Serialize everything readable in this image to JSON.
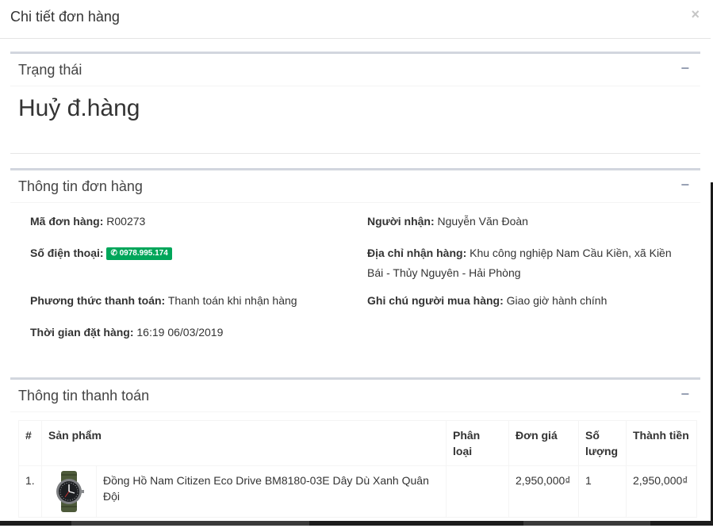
{
  "modal": {
    "title": "Chi tiết đơn hàng",
    "close_icon": "×"
  },
  "status_box": {
    "title": "Trạng thái",
    "collapse_icon": "−",
    "status": "Huỷ đ.hàng"
  },
  "order_box": {
    "title": "Thông tin đơn hàng",
    "collapse_icon": "−",
    "order_code_label": "Mã đơn hàng:",
    "order_code": "R00273",
    "recipient_label": "Người nhận:",
    "recipient": "Nguyễn Văn Đoàn",
    "phone_label": "Số điện thoại:",
    "phone": "0978.995.174",
    "address_label": "Địa chỉ nhận hàng:",
    "address_line1": "Khu công nghiệp Nam Cầu Kiền, xã Kiền",
    "address_line2": "Bái - Thủy Nguyên - Hải Phòng",
    "payment_label": "Phương thức thanh toán:",
    "payment": "Thanh toán khi nhận hàng",
    "note_label": "Ghi chú người mua hàng:",
    "note": "Giao giờ hành chính",
    "time_label": "Thời gian đặt hàng:",
    "time": "16:19 06/03/2019"
  },
  "payment_box": {
    "title": "Thông tin thanh toán",
    "collapse_icon": "−",
    "columns": {
      "index": "#",
      "product": "Sản phẩm",
      "category_1": "Phân",
      "category_2": "loại",
      "unit_price": "Đơn giá",
      "quantity_1": "Số",
      "quantity_2": "lượng",
      "total": "Thành tiền"
    },
    "rows": [
      {
        "index": "1.",
        "product_name": "Đồng Hồ Nam Citizen Eco Drive BM8180-03E Dây Dù Xanh Quân Đội",
        "category": "",
        "unit_price": "2,950,000₫",
        "quantity": "1",
        "total": "2,950,000₫",
        "thumbnail_icon": "watch-icon"
      }
    ]
  },
  "colors": {
    "badge_green": "#00a65a",
    "box_border": "#d2d6de",
    "tool_icon": "#97a0b3"
  }
}
